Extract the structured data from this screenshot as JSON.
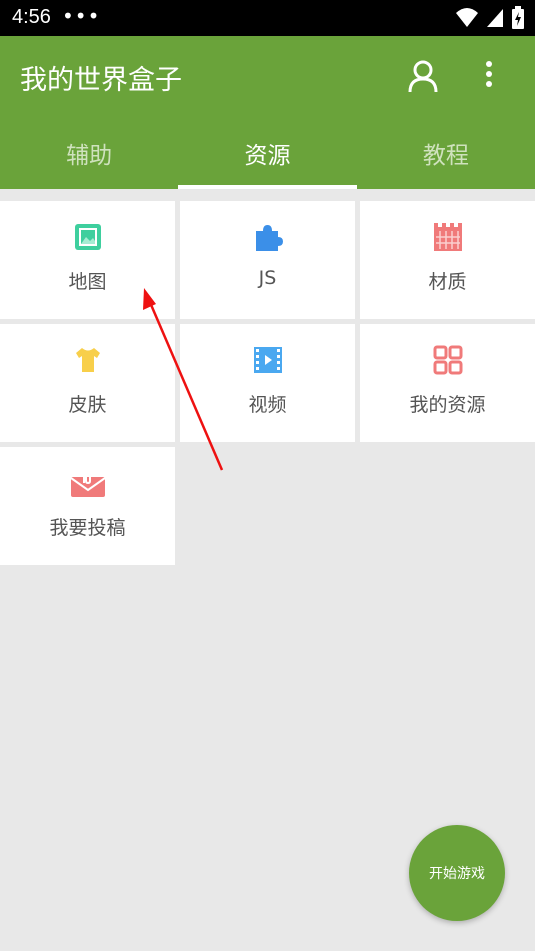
{
  "status_bar": {
    "time": "4:56",
    "dots": "•••",
    "icons": [
      "wifi-icon",
      "signal-icon",
      "battery-charging-icon"
    ]
  },
  "app_bar": {
    "title": "我的世界盒子",
    "actions": [
      "profile-icon",
      "more-vert-icon"
    ]
  },
  "tabs": [
    {
      "label": "辅助",
      "active": false
    },
    {
      "label": "资源",
      "active": true
    },
    {
      "label": "教程",
      "active": false
    }
  ],
  "grid": {
    "items": [
      {
        "label": "地图",
        "icon": "map-image-icon",
        "color": "#3ecf9e"
      },
      {
        "label": "JS",
        "icon": "puzzle-icon",
        "color": "#3b8fe8"
      },
      {
        "label": "材质",
        "icon": "texture-icon",
        "color": "#f07a7a"
      },
      {
        "label": "皮肤",
        "icon": "tshirt-icon",
        "color": "#f8cf4a"
      },
      {
        "label": "视频",
        "icon": "film-icon",
        "color": "#4aa8f0"
      },
      {
        "label": "我的资源",
        "icon": "grid-icon",
        "color": "#f07a7a"
      },
      {
        "label": "我要投稿",
        "icon": "envelope-clip-icon",
        "color": "#f07a7a"
      }
    ]
  },
  "fab": {
    "label": "开始游戏"
  },
  "colors": {
    "primary": "#6aa33a",
    "annotation_arrow": "#ee1111"
  }
}
